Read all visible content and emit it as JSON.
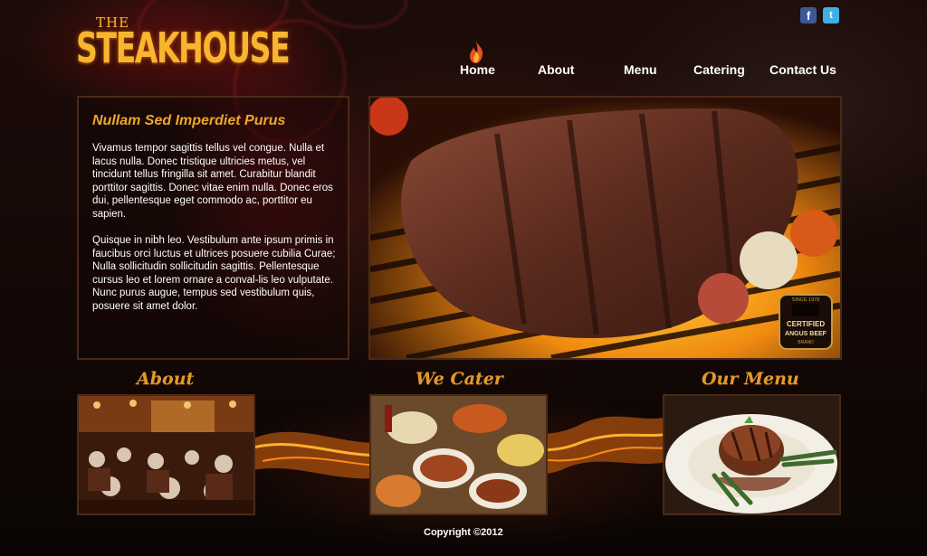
{
  "brand": {
    "the": "THE",
    "name": "STEAKHOUSE"
  },
  "social": [
    {
      "icon": "facebook-icon",
      "glyph": "f"
    },
    {
      "icon": "twitter-icon",
      "glyph": "t"
    }
  ],
  "nav": {
    "items": [
      {
        "label": "Home",
        "active": true
      },
      {
        "label": "About"
      },
      {
        "label": "Menu"
      },
      {
        "label": "Catering"
      },
      {
        "label": "Contact Us"
      }
    ]
  },
  "intro": {
    "heading": "Nullam Sed Imperdiet Purus",
    "p1": "Vivamus tempor sagittis tellus vel congue. Nulla et lacus nulla. Donec tristique ultricies metus, vel tincidunt tellus fringilla sit amet. Curabitur blandit porttitor sagittis. Donec vitae enim nulla. Donec eros dui, pellentesque eget commodo ac, porttitor eu sapien.",
    "p2": "Quisque in nibh leo. Vestibulum ante ipsum primis in faucibus orci luctus et ultrices posuere cubilia Curae; Nulla sollicitudin sollicitudin sagittis. Pellentesque cursus leo et lorem ornare a conval-lis leo vulputate. Nunc purus augue, tempus sed vestibulum quis, posuere sit amet dolor."
  },
  "hero": {
    "badge": {
      "top": "SINCE 1978",
      "line1": "CERTIFIED",
      "line2": "ANGUS BEEF",
      "line3": "BRAND"
    }
  },
  "sections": [
    {
      "title": "About"
    },
    {
      "title": "We Cater"
    },
    {
      "title": "Our Menu"
    }
  ],
  "footer": {
    "copyright": "Copyright ©2012"
  },
  "colors": {
    "accent": "#f0a52a",
    "border": "#4a2a18",
    "background": "#0c0605"
  }
}
